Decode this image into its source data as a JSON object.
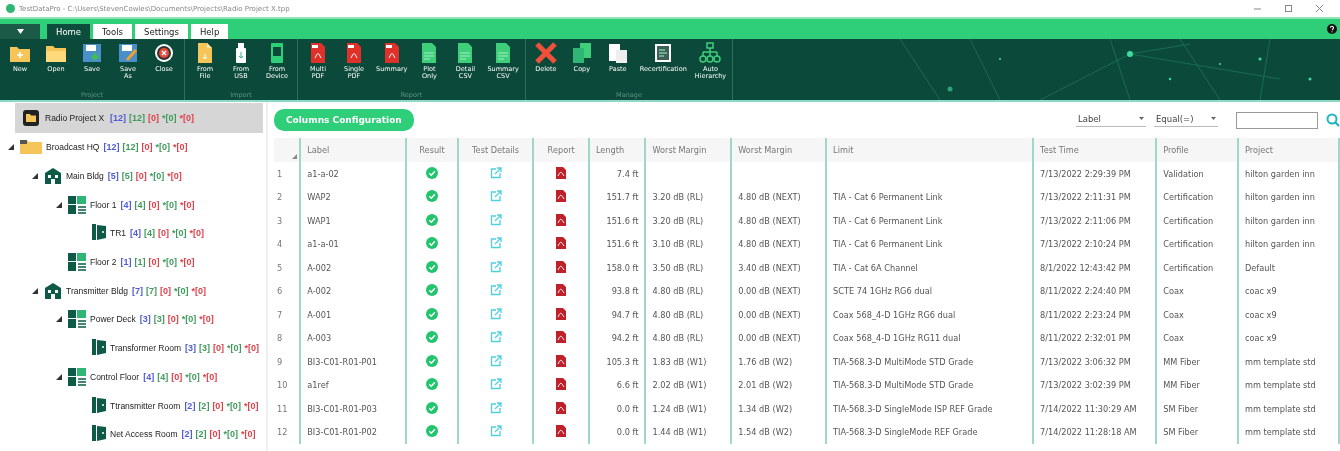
{
  "window": {
    "title": "TestDataPro - C:\\Users\\StevenCowles\\Documents\\Projects\\Radio Project X.tpp"
  },
  "tabs": [
    {
      "label": "Home",
      "selected": true
    },
    {
      "label": "Tools",
      "selected": false
    },
    {
      "label": "Settings",
      "selected": false
    },
    {
      "label": "Help",
      "selected": false
    }
  ],
  "ribbon": [
    {
      "label": "Project",
      "buttons": [
        {
          "label": "New",
          "kind": "new"
        },
        {
          "label": "Open",
          "kind": "open"
        },
        {
          "label": "Save",
          "kind": "save"
        },
        {
          "label": "Save\nAs",
          "kind": "saveas"
        },
        {
          "label": "Close",
          "kind": "close"
        }
      ]
    },
    {
      "label": "Import",
      "buttons": [
        {
          "label": "From\nFile",
          "kind": "file"
        },
        {
          "label": "From\nUSB",
          "kind": "usb"
        },
        {
          "label": "From\nDevice",
          "kind": "device"
        }
      ]
    },
    {
      "label": "Report",
      "buttons": [
        {
          "label": "Multi\nPDF",
          "kind": "pdf"
        },
        {
          "label": "Single\nPDF",
          "kind": "pdf"
        },
        {
          "label": "Summary",
          "kind": "pdf"
        },
        {
          "label": "Plot\nOnly",
          "kind": "csv"
        },
        {
          "label": "Detail\nCSV",
          "kind": "csv"
        },
        {
          "label": "Summary\nCSV",
          "kind": "csv"
        }
      ]
    },
    {
      "label": "Manage",
      "buttons": [
        {
          "label": "Delete",
          "kind": "delete"
        },
        {
          "label": "Copy",
          "kind": "copy"
        },
        {
          "label": "Paste",
          "kind": "paste"
        },
        {
          "label": "Recertification",
          "kind": "cert"
        },
        {
          "label": "Auto\nHierarchy",
          "kind": "hierarchy"
        }
      ]
    }
  ],
  "project": {
    "label": "Radio Project X",
    "selected": true,
    "counts": [
      {
        "text": "[12]",
        "color": "#4f5bd5"
      },
      {
        "text": "[12]",
        "color": "#3f9a5c"
      },
      {
        "text": "[0]",
        "color": "#e0404a"
      },
      {
        "text": "*[0]",
        "color": "#3f9a5c"
      },
      {
        "text": "*[0]",
        "color": "#e0404a"
      }
    ]
  },
  "tree": [
    {
      "label": "Broadcast HQ",
      "kind": "site",
      "selected": false,
      "expanded": true,
      "counts": [
        {
          "text": "[12]",
          "color": "#4f5bd5"
        },
        {
          "text": "[12]",
          "color": "#3f9a5c"
        },
        {
          "text": "[0]",
          "color": "#e0404a"
        },
        {
          "text": "*[0]",
          "color": "#3f9a5c"
        },
        {
          "text": "*[0]",
          "color": "#e0404a"
        }
      ],
      "children": [
        {
          "label": "Main Bldg",
          "kind": "building",
          "selected": false,
          "expanded": true,
          "counts": [
            {
              "text": "[5]",
              "color": "#4f5bd5"
            },
            {
              "text": "[5]",
              "color": "#3f9a5c"
            },
            {
              "text": "[0]",
              "color": "#e0404a"
            },
            {
              "text": "*[0]",
              "color": "#3f9a5c"
            },
            {
              "text": "*[0]",
              "color": "#e0404a"
            }
          ],
          "children": [
            {
              "label": "Floor 1",
              "kind": "floor",
              "selected": false,
              "expanded": true,
              "counts": [
                {
                  "text": "[4]",
                  "color": "#4f5bd5"
                },
                {
                  "text": "[4]",
                  "color": "#3f9a5c"
                },
                {
                  "text": "[0]",
                  "color": "#e0404a"
                },
                {
                  "text": "*[0]",
                  "color": "#3f9a5c"
                },
                {
                  "text": "*[0]",
                  "color": "#e0404a"
                }
              ],
              "children": [
                {
                  "label": "TR1",
                  "kind": "room",
                  "selected": false,
                  "counts": [
                    {
                      "text": "[4]",
                      "color": "#4f5bd5"
                    },
                    {
                      "text": "[4]",
                      "color": "#3f9a5c"
                    },
                    {
                      "text": "[0]",
                      "color": "#e0404a"
                    },
                    {
                      "text": "*[0]",
                      "color": "#3f9a5c"
                    },
                    {
                      "text": "*[0]",
                      "color": "#e0404a"
                    }
                  ]
                }
              ]
            },
            {
              "label": "Floor 2",
              "kind": "floor",
              "selected": false,
              "counts": [
                {
                  "text": "[1]",
                  "color": "#4f5bd5"
                },
                {
                  "text": "[1]",
                  "color": "#3f9a5c"
                },
                {
                  "text": "[0]",
                  "color": "#e0404a"
                },
                {
                  "text": "*[0]",
                  "color": "#3f9a5c"
                },
                {
                  "text": "*[0]",
                  "color": "#e0404a"
                }
              ]
            }
          ]
        },
        {
          "label": "Transmitter Bldg",
          "kind": "building",
          "selected": false,
          "expanded": true,
          "counts": [
            {
              "text": "[7]",
              "color": "#4f5bd5"
            },
            {
              "text": "[7]",
              "color": "#3f9a5c"
            },
            {
              "text": "[0]",
              "color": "#e0404a"
            },
            {
              "text": "*[0]",
              "color": "#3f9a5c"
            },
            {
              "text": "*[0]",
              "color": "#e0404a"
            }
          ],
          "children": [
            {
              "label": "Power Deck",
              "kind": "floor",
              "selected": false,
              "expanded": true,
              "counts": [
                {
                  "text": "[3]",
                  "color": "#4f5bd5"
                },
                {
                  "text": "[3]",
                  "color": "#3f9a5c"
                },
                {
                  "text": "[0]",
                  "color": "#e0404a"
                },
                {
                  "text": "*[0]",
                  "color": "#3f9a5c"
                },
                {
                  "text": "*[0]",
                  "color": "#e0404a"
                }
              ],
              "children": [
                {
                  "label": "Transformer Room",
                  "kind": "room",
                  "selected": false,
                  "counts": [
                    {
                      "text": "[3]",
                      "color": "#4f5bd5"
                    },
                    {
                      "text": "[3]",
                      "color": "#3f9a5c"
                    },
                    {
                      "text": "[0]",
                      "color": "#e0404a"
                    },
                    {
                      "text": "*[0]",
                      "color": "#3f9a5c"
                    },
                    {
                      "text": "*[0]",
                      "color": "#e0404a"
                    }
                  ]
                }
              ]
            },
            {
              "label": "Control Floor",
              "kind": "floor",
              "selected": false,
              "expanded": true,
              "counts": [
                {
                  "text": "[4]",
                  "color": "#4f5bd5"
                },
                {
                  "text": "[4]",
                  "color": "#3f9a5c"
                },
                {
                  "text": "[0]",
                  "color": "#e0404a"
                },
                {
                  "text": "*[0]",
                  "color": "#3f9a5c"
                },
                {
                  "text": "*[0]",
                  "color": "#e0404a"
                }
              ],
              "children": [
                {
                  "label": "Ttransmitter Room",
                  "kind": "room",
                  "selected": false,
                  "counts": [
                    {
                      "text": "[2]",
                      "color": "#4f5bd5"
                    },
                    {
                      "text": "[2]",
                      "color": "#3f9a5c"
                    },
                    {
                      "text": "[0]",
                      "color": "#e0404a"
                    },
                    {
                      "text": "*[0]",
                      "color": "#3f9a5c"
                    },
                    {
                      "text": "*[0]",
                      "color": "#e0404a"
                    }
                  ]
                },
                {
                  "label": "Net Access Room",
                  "kind": "room",
                  "selected": false,
                  "counts": [
                    {
                      "text": "[2]",
                      "color": "#4f5bd5"
                    },
                    {
                      "text": "[2]",
                      "color": "#3f9a5c"
                    },
                    {
                      "text": "[0]",
                      "color": "#e0404a"
                    },
                    {
                      "text": "*[0]",
                      "color": "#3f9a5c"
                    },
                    {
                      "text": "*[0]",
                      "color": "#e0404a"
                    }
                  ]
                }
              ]
            }
          ]
        }
      ]
    }
  ],
  "columns_button": "Columns Configuration",
  "filter": {
    "field": "Label",
    "operator": "Equal(=)"
  },
  "table": {
    "columns": [
      "Label",
      "Result",
      "Test Details",
      "Report",
      "Length",
      "Worst Margin",
      "Worst Margin",
      "Limit",
      "Test Time",
      "Profile",
      "Project"
    ],
    "rows": [
      {
        "number": "1",
        "label": "a1-a-02",
        "passed": true,
        "length": "7.4 ft",
        "test_time": "7/13/2022 2:29:39 PM",
        "profile": "Validation",
        "project": "hilton garden inn"
      },
      {
        "number": "2",
        "label": "WAP2",
        "passed": true,
        "length": "151.7 ft",
        "margin_1": "3.20 dB (RL)",
        "margin_2": "4.80 dB (NEXT)",
        "limit": "TIA - Cat 6 Permanent Link",
        "test_time": "7/13/2022 2:11:31 PM",
        "profile": "Certification",
        "project": "hilton garden inn"
      },
      {
        "number": "3",
        "label": "WAP1",
        "passed": true,
        "length": "151.6 ft",
        "margin_1": "3.20 dB (RL)",
        "margin_2": "4.80 dB (NEXT)",
        "limit": "TIA - Cat 6 Permanent Link",
        "test_time": "7/13/2022 2:11:06 PM",
        "profile": "Certification",
        "project": "hilton garden inn"
      },
      {
        "number": "4",
        "label": "a1-a-01",
        "passed": true,
        "length": "151.6 ft",
        "margin_1": "3.10 dB (RL)",
        "margin_2": "4.80 dB (NEXT)",
        "limit": "TIA - Cat 6 Permanent Link",
        "test_time": "7/13/2022 2:10:24 PM",
        "profile": "Certification",
        "project": "hilton garden inn"
      },
      {
        "number": "5",
        "label": "A-002",
        "passed": true,
        "length": "158.0 ft",
        "margin_1": "3.50 dB (RL)",
        "margin_2": "3.40 dB (NEXT)",
        "limit": "TIA - Cat 6A Channel",
        "test_time": "8/1/2022 12:43:42 PM",
        "profile": "Certification",
        "project": "Default"
      },
      {
        "number": "6",
        "label": "A-002",
        "passed": true,
        "length": "93.8 ft",
        "margin_1": "4.80 dB (RL)",
        "margin_2": "0.00 dB (NEXT)",
        "limit": "SCTE 74 1GHz RG6 dual",
        "test_time": "8/11/2022 2:24:40 PM",
        "profile": "Coax",
        "project": "coac x9"
      },
      {
        "number": "7",
        "label": "A-001",
        "passed": true,
        "length": "94.7 ft",
        "margin_1": "4.80 dB (RL)",
        "margin_2": "0.00 dB (NEXT)",
        "limit": "Coax 568_4-D 1GHz RG6 dual",
        "test_time": "8/11/2022 2:23:24 PM",
        "profile": "Coax",
        "project": "coac x9"
      },
      {
        "number": "8",
        "label": "A-003",
        "passed": true,
        "length": "94.2 ft",
        "margin_1": "4.80 dB (RL)",
        "margin_2": "0.00 dB (NEXT)",
        "limit": "Coax 568_4-D 1GHz RG11 dual",
        "test_time": "8/11/2022 2:32:01 PM",
        "profile": "Coax",
        "project": "coac x9"
      },
      {
        "number": "9",
        "label": "BI3-C01-R01-P01",
        "passed": true,
        "length": "105.3 ft",
        "margin_1": "1.83 dB (W1)",
        "margin_2": "1.76 dB (W2)",
        "limit": "TIA-568.3-D MultiMode STD Grade",
        "test_time": "7/13/2022 3:06:32 PM",
        "profile": "MM Fiber",
        "project": "mm template std"
      },
      {
        "number": "10",
        "label": "a1ref",
        "passed": true,
        "length": "6.6 ft",
        "margin_1": "2.02 dB (W1)",
        "margin_2": "2.01 dB (W2)",
        "limit": "TIA-568.3-D MultiMode STD Grade",
        "test_time": "7/13/2022 3:02:39 PM",
        "profile": "MM Fiber",
        "project": "mm template std"
      },
      {
        "number": "11",
        "label": "BI3-C01-R01-P03",
        "passed": true,
        "length": "0.0 ft",
        "margin_1": "1.24 dB (W1)",
        "margin_2": "1.34 dB (W2)",
        "limit": "TIA-568.3-D SingleMode ISP REF Grade",
        "test_time": "7/14/2022 11:30:29 AM",
        "profile": "SM Fiber",
        "project": "mm template std"
      },
      {
        "number": "12",
        "label": "BI3-C01-R01-P02",
        "passed": true,
        "length": "0.0 ft",
        "margin_1": "1.44 dB (W1)",
        "margin_2": "1.54 dB (W2)",
        "limit": "TIA-568.3-D SingleMode REF Grade",
        "test_time": "7/14/2022 11:28:18 AM",
        "profile": "SM Fiber",
        "project": "mm template std"
      }
    ]
  }
}
